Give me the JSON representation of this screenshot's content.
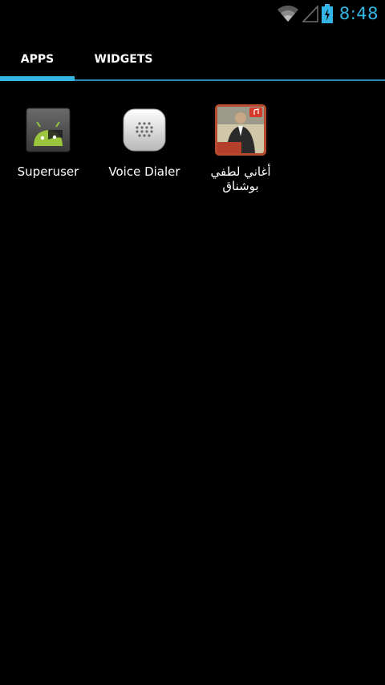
{
  "status_bar": {
    "time": "8:48",
    "wifi_icon": "wifi-icon",
    "signal_icon": "no-signal-icon",
    "battery_icon": "battery-charging-icon",
    "accent_color": "#33b5e5"
  },
  "tabs": [
    {
      "label": "APPS",
      "selected": true
    },
    {
      "label": "WIDGETS",
      "selected": false
    }
  ],
  "apps": [
    {
      "label": "Superuser",
      "icon": "superuser-android-icon"
    },
    {
      "label": "Voice Dialer",
      "icon": "voice-dialer-icon"
    },
    {
      "label": "أغاني لطفي بوشناق",
      "icon": "album-art-icon"
    }
  ]
}
